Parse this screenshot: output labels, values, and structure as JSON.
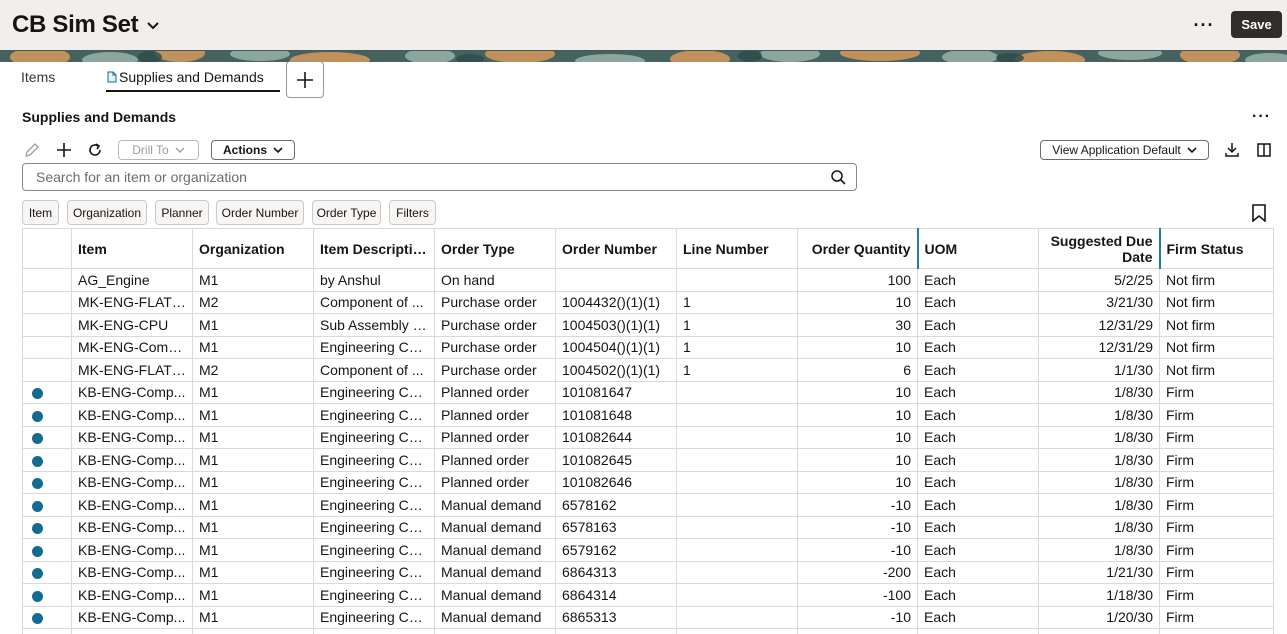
{
  "header": {
    "title": "CB Sim Set",
    "more": "···",
    "save_label": "Save"
  },
  "tabs": [
    {
      "label": "Items"
    },
    {
      "label": "Supplies and Demands",
      "active": true
    }
  ],
  "section": {
    "title": "Supplies and Demands",
    "more": "···"
  },
  "toolbar": {
    "drill_to": "Drill To",
    "actions": "Actions",
    "view_select": "View Application Default"
  },
  "search": {
    "placeholder": "Search for an item or organization"
  },
  "chips": [
    "Item",
    "Organization",
    "Planner",
    "Order Number",
    "Order Type",
    "Filters"
  ],
  "table": {
    "columns": [
      "",
      "Item",
      "Organization",
      "Item Description",
      "Order Type",
      "Order Number",
      "Line Number",
      "Order Quantity",
      "UOM",
      "Suggested Due Date",
      "Firm Status"
    ],
    "rows": [
      {
        "dot": false,
        "item": "AG_Engine",
        "org": "M1",
        "desc": "by Anshul",
        "type": "On hand",
        "number": "",
        "line": "",
        "qty": "100",
        "uom": "Each",
        "due": "5/2/25",
        "firm": "Not firm"
      },
      {
        "dot": false,
        "item": "MK-ENG-FLATP...",
        "org": "M2",
        "desc": "Component of ...",
        "type": "Purchase order",
        "number": "1004432()(1)(1)",
        "line": "1",
        "qty": "10",
        "uom": "Each",
        "due": "3/21/30",
        "firm": "Not firm"
      },
      {
        "dot": false,
        "item": "MK-ENG-CPU",
        "org": "M1",
        "desc": "Sub Assembly f...",
        "type": "Purchase order",
        "number": "1004503()(1)(1)",
        "line": "1",
        "qty": "30",
        "uom": "Each",
        "due": "12/31/29",
        "firm": "Not firm"
      },
      {
        "dot": false,
        "item": "MK-ENG-Comp...",
        "org": "M1",
        "desc": "Engineering Co...",
        "type": "Purchase order",
        "number": "1004504()(1)(1)",
        "line": "1",
        "qty": "10",
        "uom": "Each",
        "due": "12/31/29",
        "firm": "Not firm"
      },
      {
        "dot": false,
        "item": "MK-ENG-FLATP...",
        "org": "M2",
        "desc": "Component of ...",
        "type": "Purchase order",
        "number": "1004502()(1)(1)",
        "line": "1",
        "qty": "6",
        "uom": "Each",
        "due": "1/1/30",
        "firm": "Not firm"
      },
      {
        "dot": true,
        "item": "KB-ENG-Comp...",
        "org": "M1",
        "desc": "Engineering Co...",
        "type": "Planned order",
        "number": "101081647",
        "line": "",
        "qty": "10",
        "uom": "Each",
        "due": "1/8/30",
        "firm": "Firm"
      },
      {
        "dot": true,
        "item": "KB-ENG-Comp...",
        "org": "M1",
        "desc": "Engineering Co...",
        "type": "Planned order",
        "number": "101081648",
        "line": "",
        "qty": "10",
        "uom": "Each",
        "due": "1/8/30",
        "firm": "Firm"
      },
      {
        "dot": true,
        "item": "KB-ENG-Comp...",
        "org": "M1",
        "desc": "Engineering Co...",
        "type": "Planned order",
        "number": "101082644",
        "line": "",
        "qty": "10",
        "uom": "Each",
        "due": "1/8/30",
        "firm": "Firm"
      },
      {
        "dot": true,
        "item": "KB-ENG-Comp...",
        "org": "M1",
        "desc": "Engineering Co...",
        "type": "Planned order",
        "number": "101082645",
        "line": "",
        "qty": "10",
        "uom": "Each",
        "due": "1/8/30",
        "firm": "Firm"
      },
      {
        "dot": true,
        "item": "KB-ENG-Comp...",
        "org": "M1",
        "desc": "Engineering Co...",
        "type": "Planned order",
        "number": "101082646",
        "line": "",
        "qty": "10",
        "uom": "Each",
        "due": "1/8/30",
        "firm": "Firm"
      },
      {
        "dot": true,
        "item": "KB-ENG-Comp...",
        "org": "M1",
        "desc": "Engineering Co...",
        "type": "Manual demand",
        "number": "6578162",
        "line": "",
        "qty": "-10",
        "uom": "Each",
        "due": "1/8/30",
        "firm": "Firm"
      },
      {
        "dot": true,
        "item": "KB-ENG-Comp...",
        "org": "M1",
        "desc": "Engineering Co...",
        "type": "Manual demand",
        "number": "6578163",
        "line": "",
        "qty": "-10",
        "uom": "Each",
        "due": "1/8/30",
        "firm": "Firm"
      },
      {
        "dot": true,
        "item": "KB-ENG-Comp...",
        "org": "M1",
        "desc": "Engineering Co...",
        "type": "Manual demand",
        "number": "6579162",
        "line": "",
        "qty": "-10",
        "uom": "Each",
        "due": "1/8/30",
        "firm": "Firm"
      },
      {
        "dot": true,
        "item": "KB-ENG-Comp...",
        "org": "M1",
        "desc": "Engineering Co...",
        "type": "Manual demand",
        "number": "6864313",
        "line": "",
        "qty": "-200",
        "uom": "Each",
        "due": "1/21/30",
        "firm": "Firm"
      },
      {
        "dot": true,
        "item": "KB-ENG-Comp...",
        "org": "M1",
        "desc": "Engineering Co...",
        "type": "Manual demand",
        "number": "6864314",
        "line": "",
        "qty": "-100",
        "uom": "Each",
        "due": "1/18/30",
        "firm": "Firm"
      },
      {
        "dot": true,
        "item": "KB-ENG-Comp...",
        "org": "M1",
        "desc": "Engineering Co...",
        "type": "Manual demand",
        "number": "6865313",
        "line": "",
        "qty": "-10",
        "uom": "Each",
        "due": "1/20/30",
        "firm": "Firm"
      }
    ]
  },
  "colors": {
    "save_bg": "#312d2a",
    "dot": "#116c8f",
    "column_separator": "#227e9e",
    "header_bg": "#f1efed"
  }
}
